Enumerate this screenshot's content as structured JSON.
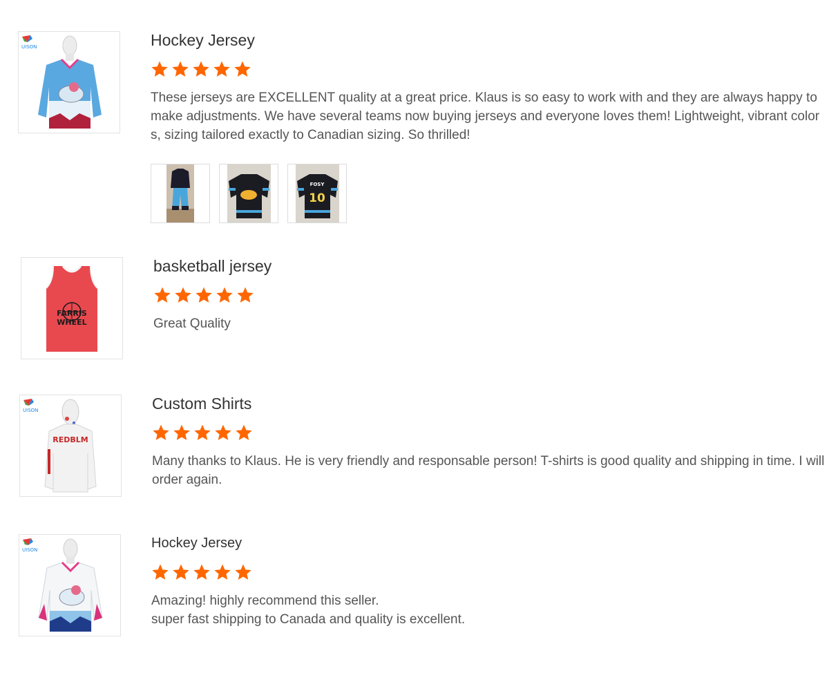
{
  "reviews": [
    {
      "product": "Hockey Jersey",
      "rating": 5,
      "text": "These jerseys are EXCELLENT quality at a great price. Klaus is so easy to work with and they are always happy to make adjustments. We have several teams now buying jerseys and everyone loves them! Lightweight, vibrant colors, sizing tailored exactly to Canadian sizing. So thrilled!",
      "thumb_icon": "hockey-jersey-blue-image",
      "gallery": [
        "jersey-set-photo",
        "black-jersey-front-photo",
        "black-jersey-back-photo"
      ],
      "gallery_text": {
        "back_name": "FOSY",
        "back_number": "10"
      }
    },
    {
      "product": "basketball jersey",
      "rating": 5,
      "text": "Great Quality",
      "thumb_icon": "red-basketball-jersey-image",
      "logo_text": [
        "FARRIS",
        "WHEEL"
      ]
    },
    {
      "product": "Custom Shirts",
      "rating": 5,
      "text": "Many thanks to Klaus. He is very friendly and responsable person! T-shirts is good quality and shipping in time. I will order again.",
      "thumb_icon": "white-hoodie-shirt-image",
      "logo_text": "REDBLM"
    },
    {
      "product": "Hockey Jersey",
      "rating": 5,
      "text": "Amazing!  highly recommend this seller.\nsuper fast shipping to Canada and quality is excellent.",
      "thumb_icon": "hockey-jersey-white-image"
    }
  ],
  "brand_badge": "UISON",
  "colors": {
    "star": "#ff6600",
    "title": "#333333",
    "text": "#555555",
    "border": "#e2e2e2"
  }
}
